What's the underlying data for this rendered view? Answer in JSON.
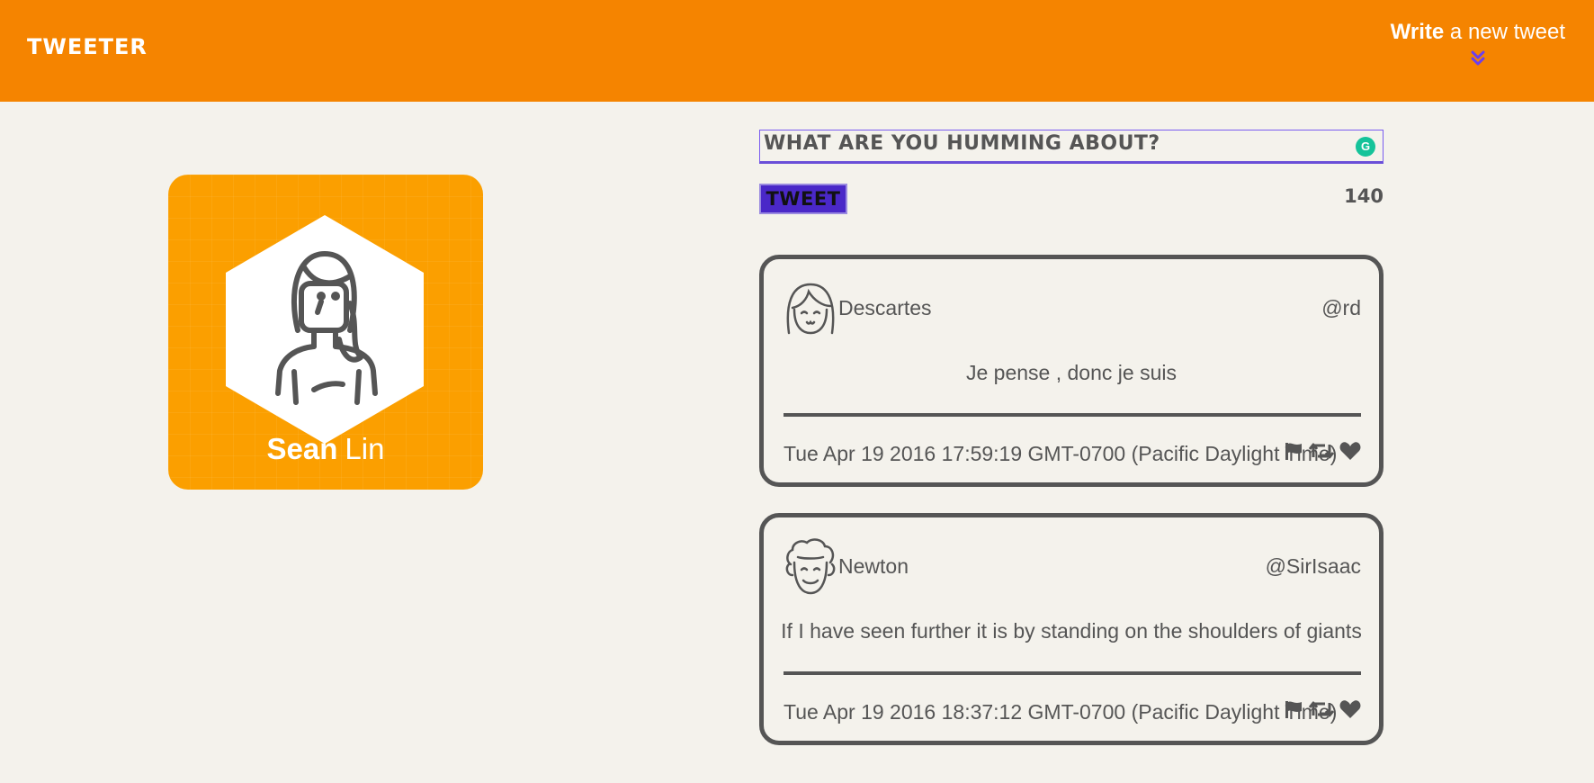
{
  "nav": {
    "brand": "TWEETER",
    "compose_strong": "Write",
    "compose_rest": "a new tweet"
  },
  "profile": {
    "first_name": "Sean",
    "last_name": "Lin"
  },
  "composer": {
    "placeholder": "WHAT ARE YOU HUMMING ABOUT?",
    "button_label": "TWEET",
    "char_count": "140"
  },
  "tweets": [
    {
      "author": "Descartes",
      "handle": "@rd",
      "text": "Je pense , donc je suis",
      "timestamp": "Tue Apr 19 2016 17:59:19 GMT-0700 (Pacific Daylight Time)"
    },
    {
      "author": "Newton",
      "handle": "@SirIsaac",
      "text": "If I have seen further it is by standing on the shoulders of giants",
      "timestamp": "Tue Apr 19 2016 18:37:12 GMT-0700 (Pacific Daylight Time)"
    }
  ],
  "colors": {
    "nav_bg": "#f58400",
    "page_bg": "#f4f2ec",
    "profile_bg": "#fb9f00",
    "button_bg": "#4a28c8",
    "accent_purple": "#7a5cf0",
    "text": "#555555"
  },
  "icons": [
    "chevron-double-down-icon",
    "grammarly-icon",
    "flag-icon",
    "retweet-icon",
    "heart-icon"
  ]
}
